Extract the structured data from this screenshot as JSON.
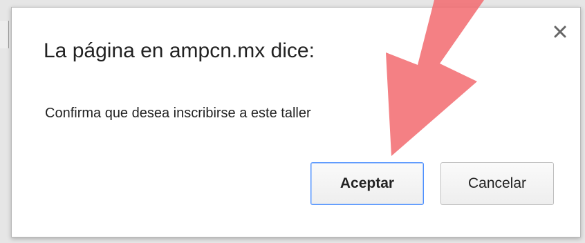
{
  "dialog": {
    "title": "La página en ampcn.mx dice:",
    "message": "Confirma que desea inscribirse a este taller",
    "close_label": "×",
    "accept_label": "Aceptar",
    "cancel_label": "Cancelar"
  },
  "overlay": {
    "arrow_color": "#f26a6f",
    "arrow_icon": "annotation-arrow-icon"
  },
  "colors": {
    "accept_border": "#4d90fe"
  }
}
